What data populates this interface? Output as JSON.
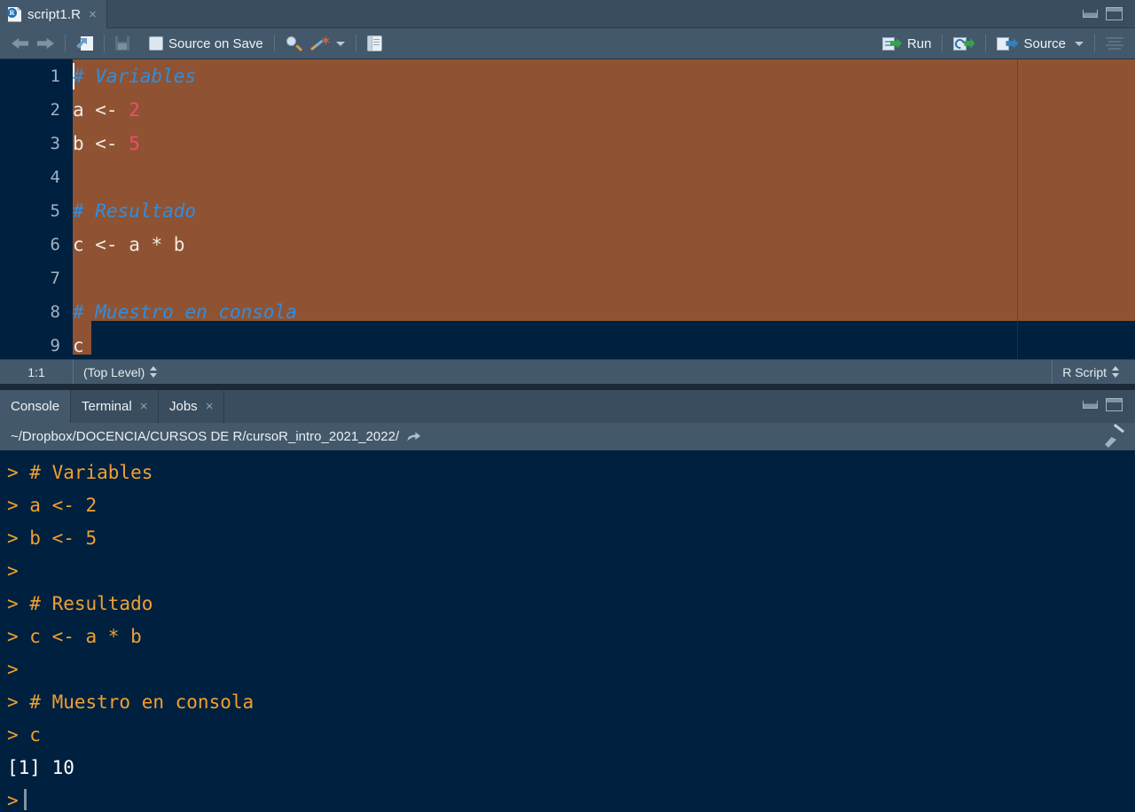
{
  "app": {
    "name": "RStudio"
  },
  "source_pane": {
    "tab": {
      "filename": "script1.R",
      "file_icon": "r-document-icon",
      "close_icon": "×"
    },
    "window_controls": {
      "minimize": "minimize-icon",
      "maximize": "maximize-icon"
    },
    "toolbar": {
      "back_icon": "arrow-left-icon",
      "forward_icon": "arrow-right-icon",
      "popout_icon": "show-in-new-window-icon",
      "save_icon": "save-icon",
      "source_on_save_label": "Source on Save",
      "find_icon": "magnifier-icon",
      "code_tools_icon": "magic-wand-icon",
      "code_tools_caret": "chevron-down-icon",
      "compile_report_icon": "notebook-icon",
      "run_label": "Run",
      "run_icon": "run-icon",
      "rerun_icon": "rerun-icon",
      "source_label": "Source",
      "source_icon": "source-icon",
      "source_caret": "chevron-down-icon",
      "outline_icon": "document-outline-icon"
    },
    "editor": {
      "gutter": [
        "1",
        "2",
        "3",
        "4",
        "5",
        "6",
        "7",
        "8",
        "9"
      ],
      "lines": [
        {
          "n": 1,
          "tokens": [
            {
              "t": "# Variables",
              "k": "comment"
            }
          ]
        },
        {
          "n": 2,
          "tokens": [
            {
              "t": "a <- ",
              "k": "plain"
            },
            {
              "t": "2",
              "k": "num"
            }
          ]
        },
        {
          "n": 3,
          "tokens": [
            {
              "t": "b <- ",
              "k": "plain"
            },
            {
              "t": "5",
              "k": "num"
            }
          ]
        },
        {
          "n": 4,
          "tokens": []
        },
        {
          "n": 5,
          "tokens": [
            {
              "t": "# Resultado",
              "k": "comment"
            }
          ]
        },
        {
          "n": 6,
          "tokens": [
            {
              "t": "c <- a * b",
              "k": "plain"
            }
          ]
        },
        {
          "n": 7,
          "tokens": []
        },
        {
          "n": 8,
          "tokens": [
            {
              "t": "# Muestro en consola",
              "k": "comment"
            }
          ]
        },
        {
          "n": 9,
          "tokens": [
            {
              "t": "c",
              "k": "plain"
            }
          ]
        }
      ],
      "selection_color": "#8f5333",
      "background_color": "#00203f",
      "comment_color": "#2f8ee0",
      "number_color": "#f24a6e",
      "text_color": "#f2e9df"
    },
    "status_bar": {
      "cursor_position": "1:1",
      "scope": "(Top Level)",
      "scope_picker_icon": "updown-spinner-icon",
      "file_type": "R Script",
      "file_type_picker_icon": "updown-spinner-icon"
    }
  },
  "console_pane": {
    "tabs": [
      {
        "label": "Console",
        "active": true,
        "closable": false
      },
      {
        "label": "Terminal",
        "active": false,
        "closable": true,
        "close_icon": "×"
      },
      {
        "label": "Jobs",
        "active": false,
        "closable": true,
        "close_icon": "×"
      }
    ],
    "window_controls": {
      "minimize": "minimize-icon",
      "maximize": "maximize-icon"
    },
    "working_directory": "~/Dropbox/DOCENCIA/CURSOS DE R/cursoR_intro_2021_2022/",
    "open_dir_icon": "share-arrow-icon",
    "clear_console_icon": "broom-icon",
    "prompt": ">",
    "output": [
      {
        "text": "> # Variables",
        "kind": "input"
      },
      {
        "text": "> a <- 2",
        "kind": "input"
      },
      {
        "text": "> b <- 5",
        "kind": "input"
      },
      {
        "text": ">",
        "kind": "input"
      },
      {
        "text": "> # Resultado",
        "kind": "input"
      },
      {
        "text": "> c <- a * b",
        "kind": "input"
      },
      {
        "text": ">",
        "kind": "input"
      },
      {
        "text": "> # Muestro en consola",
        "kind": "input"
      },
      {
        "text": "> c",
        "kind": "input"
      },
      {
        "text": "[1] 10",
        "kind": "output"
      },
      {
        "text": ">",
        "kind": "prompt"
      }
    ],
    "input_color": "#f0a030",
    "output_color": "#ffffff",
    "background_color": "#00203f"
  }
}
